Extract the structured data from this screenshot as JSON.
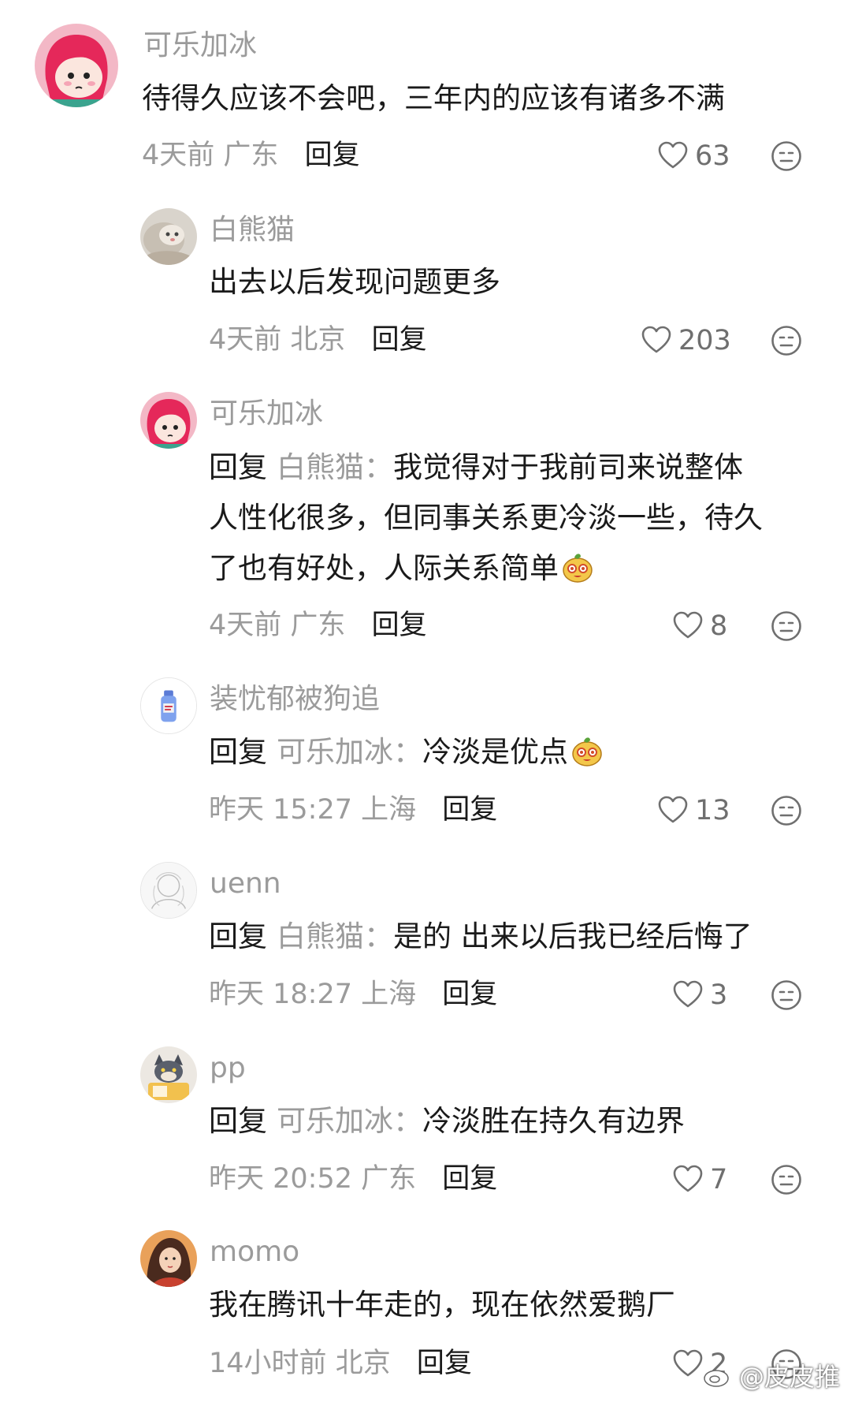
{
  "comments": [
    {
      "user": "可乐加冰",
      "text": "待得久应该不会吧，三年内的应该有诸多不满",
      "time": "4天前",
      "location": "广东",
      "reply_label": "回复",
      "likes": "63"
    },
    {
      "user": "白熊猫",
      "text": "出去以后发现问题更多",
      "time": "4天前",
      "location": "北京",
      "reply_label": "回复",
      "likes": "203"
    },
    {
      "user": "可乐加冰",
      "reply_prefix": "回复",
      "reply_to": "白熊猫：",
      "line1": "我觉得对于我前司来说整体",
      "line2": "人性化很多，但同事关系更冷淡一些，待久",
      "line3": "了也有好处，人际关系简单",
      "time": "4天前",
      "location": "广东",
      "reply_label": "回复",
      "likes": "8"
    },
    {
      "user": "装忧郁被狗追",
      "reply_prefix": "回复",
      "reply_to": "可乐加冰：",
      "text": "冷淡是优点",
      "time": "昨天 15:27",
      "location": "上海",
      "reply_label": "回复",
      "likes": "13"
    },
    {
      "user": "uenn",
      "reply_prefix": "回复",
      "reply_to": "白熊猫：",
      "text": "是的 出来以后我已经后悔了",
      "time": "昨天 18:27",
      "location": "上海",
      "reply_label": "回复",
      "likes": "3"
    },
    {
      "user": "pp",
      "reply_prefix": "回复",
      "reply_to": "可乐加冰：",
      "text": "冷淡胜在持久有边界",
      "time": "昨天 20:52",
      "location": "广东",
      "reply_label": "回复",
      "likes": "7"
    },
    {
      "user": "momo",
      "text": "我在腾讯十年走的，现在依然爱鹅厂",
      "time": "14小时前",
      "location": "北京",
      "reply_label": "回复",
      "likes": "2"
    }
  ],
  "watermark": "@皮皮推",
  "colors": {
    "text": "#1a1a1a",
    "muted": "#9b9b9b",
    "icon": "#6f6f6f"
  },
  "icons": [
    "heart-icon",
    "dislike-face-icon",
    "weibo-logo-icon",
    "emoji-icon"
  ]
}
